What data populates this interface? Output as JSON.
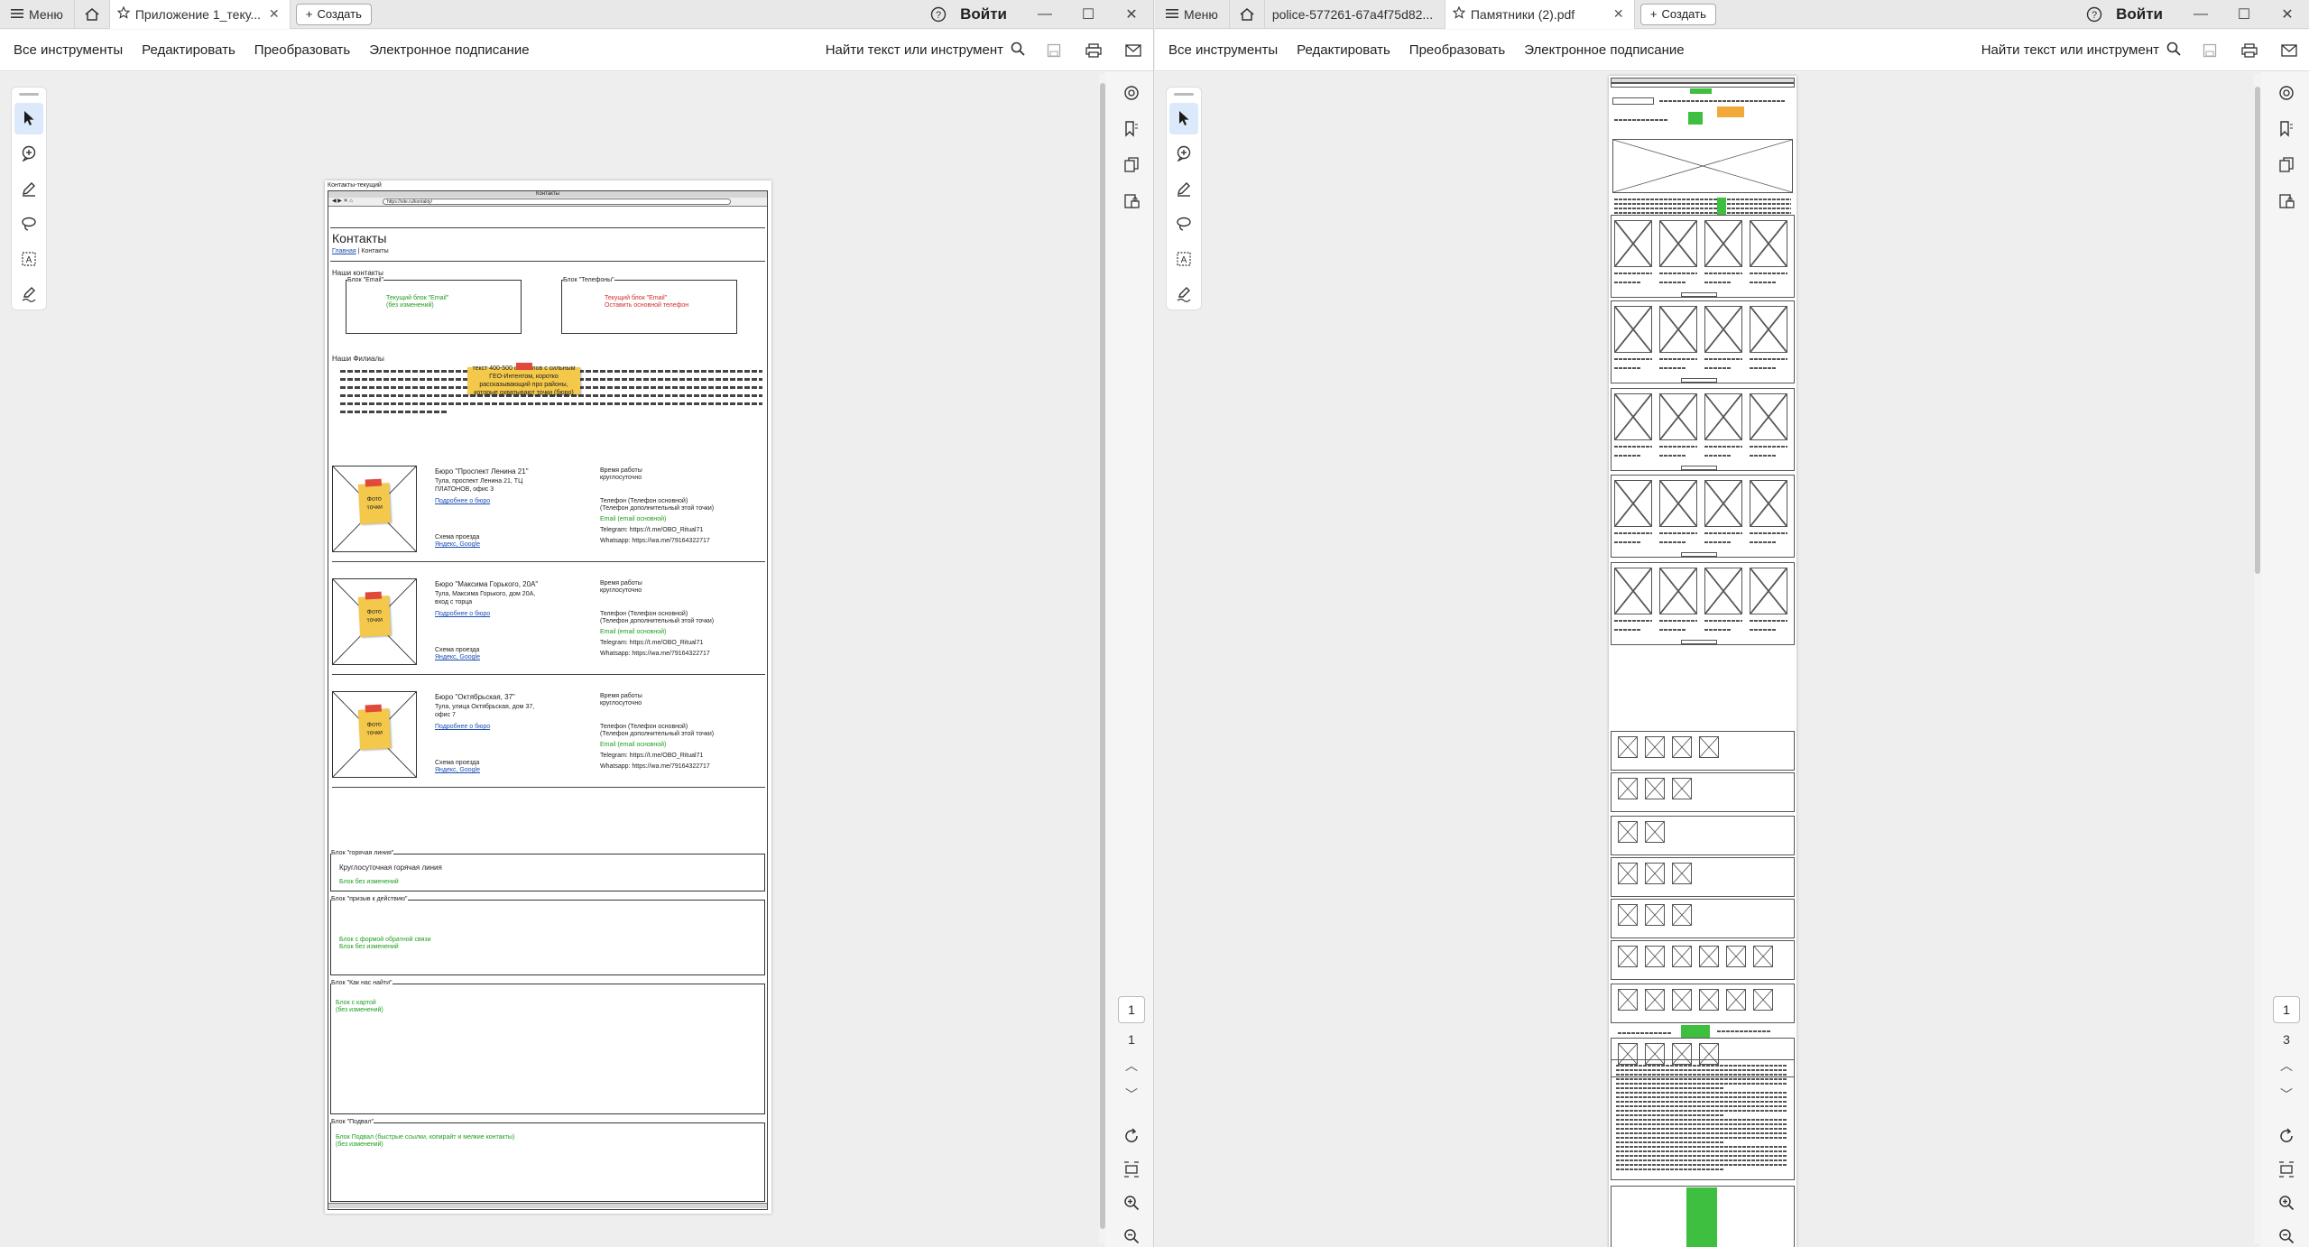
{
  "left_window": {
    "menu_label": "Меню",
    "tab_active_title": "Приложение 1_теку...",
    "create_label": "Создать",
    "signin_label": "Войти",
    "toolbar": {
      "all_tools": "Все инструменты",
      "edit": "Редактировать",
      "convert": "Преобразовать",
      "esign": "Электронное подписание",
      "find": "Найти текст или инструмент"
    },
    "page_current": "1",
    "page_total": "1"
  },
  "right_window": {
    "menu_label": "Меню",
    "tab_inactive_title": "police-577261-67a4f75d82...",
    "tab_active_title": "Памятники (2).pdf",
    "create_label": "Создать",
    "signin_label": "Войти",
    "toolbar": {
      "all_tools": "Все инструменты",
      "edit": "Редактировать",
      "convert": "Преобразовать",
      "esign": "Электронное подписание",
      "find": "Найти текст или инструмент"
    },
    "page_current": "1",
    "page_total": "3"
  },
  "left_doc": {
    "corner_label": "Контакты-текущий",
    "browser_title": "Контакты",
    "url": "https://site.ru/kontakty/",
    "page_heading": "Контакты",
    "breadcrumb_home": "Главная",
    "breadcrumb_sep": "|",
    "breadcrumb_current": "Контакты",
    "section_contacts": "Наши контакты",
    "email_block_label": "Блок \"Email\"",
    "email_block_text1": "Текущий блок \"Email\"",
    "email_block_text2": "(без изменений)",
    "phone_block_label": "Блок \"Телефоны\"",
    "phone_block_text1": "Текущий блок \"Email\"",
    "phone_block_text2": "Оставить основной телефон",
    "section_branches": "Наши Филиалы",
    "seo_note": "текст 400-500 символов с сильным ГЕО-Интентом, коротко рассказывающий про районы, которые охватывают точки (бюро)",
    "offices": [
      {
        "name": "Бюро \"Проспект Ленина 21\"",
        "address": "Тула, проспект Ленина 21, ТЦ ПЛАТОНОВ, офис 3",
        "more": "Подробнее о бюро",
        "route_label": "Схема проезда",
        "route_links": "Яндекс, Google",
        "hours_label": "Время работы",
        "hours": "круглосуточно",
        "phone_main": "Телефон (Телефон основной)",
        "phone_extra": "(Телефон дополнительный этой точки)",
        "email": "Email (email основной)",
        "telegram": "Telegram: https://t.me/OBO_Ritual71",
        "whatsapp": "Whatsapp: https://wa.me/79164322717"
      },
      {
        "name": "Бюро \"Максима Горького, 20А\"",
        "address": "Тула, Максима Горького, дом 20А, вход с торца",
        "more": "Подробнее о бюро",
        "route_label": "Схема проезда",
        "route_links": "Яндекс, Google",
        "hours_label": "Время работы",
        "hours": "круглосуточно",
        "phone_main": "Телефон (Телефон основной)",
        "phone_extra": "(Телефон дополнительный этой точки)",
        "email": "Email (email основной)",
        "telegram": "Telegram: https://t.me/OBO_Ritual71",
        "whatsapp": "Whatsapp: https://wa.me/79164322717"
      },
      {
        "name": "Бюро \"Октябрьская, 37\"",
        "address": "Тула, улица Октябрьская, дом 37, офис 7",
        "more": "Подробнее о бюро",
        "route_label": "Схема проезда",
        "route_links": "Яндекс, Google",
        "hours_label": "Время работы",
        "hours": "круглосуточно",
        "phone_main": "Телефон (Телефон основной)",
        "phone_extra": "(Телефон дополнительный этой точки)",
        "email": "Email (email основной)",
        "telegram": "Telegram: https://t.me/OBO_Ritual71",
        "whatsapp": "Whatsapp: https://wa.me/79164322717"
      }
    ],
    "photo_sticky": "Фото точки",
    "hotline_label": "Блок \"горячая линия\"",
    "hotline_title": "Круглосуточная горячая линия",
    "hotline_note": "Блок без изменений",
    "cta_label": "Блок \"призыв к действию\"",
    "cta_text1": "Блок с формой обратной связи",
    "cta_text2": "Блок без изменений",
    "map_label": "Блок \"Как нас найти\"",
    "map_text1": "Блок с картой",
    "map_text2": "(без изменений)",
    "footer_label": "Блок \"Подвал\"",
    "footer_text1": "Блок Подвал (быстрые ссылки, копирайт и мелкие контакты)",
    "footer_text2": "(без изменений)"
  },
  "colors": {
    "note_green": "#1e9e1e",
    "note_red": "#d62b2b",
    "sticky_yellow": "#f4c84a",
    "link_blue": "#1a4db3"
  }
}
